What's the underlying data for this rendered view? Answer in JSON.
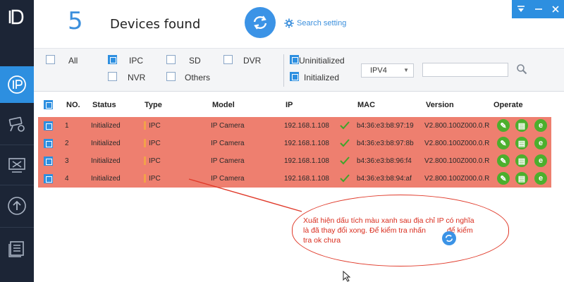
{
  "header": {
    "count": "5",
    "found_label": "Devices found",
    "search_setting": "Search setting"
  },
  "filters": {
    "all": "All",
    "ipc": "IPC",
    "sd": "SD",
    "dvr": "DVR",
    "nvr": "NVR",
    "others": "Others",
    "uninitialized": "Uninitialized",
    "initialized": "Initialized",
    "ip_version": "IPV4",
    "search_value": ""
  },
  "table": {
    "headers": {
      "no": "NO.",
      "status": "Status",
      "type": "Type",
      "model": "Model",
      "ip": "IP",
      "mac": "MAC",
      "version": "Version",
      "operate": "Operate"
    },
    "rows": [
      {
        "no": "1",
        "status": "Initialized",
        "type": "IPC",
        "model": "IP Camera",
        "ip": "192.168.1.108",
        "mac": "b4:36:e3:b8:97:19",
        "version": "V2.800.100Z000.0.R"
      },
      {
        "no": "2",
        "status": "Initialized",
        "type": "IPC",
        "model": "IP Camera",
        "ip": "192.168.1.108",
        "mac": "b4:36:e3:b8:97:8b",
        "version": "V2.800.100Z000.0.R"
      },
      {
        "no": "3",
        "status": "Initialized",
        "type": "IPC",
        "model": "IP Camera",
        "ip": "192.168.1.108",
        "mac": "b4:36:e3:b8:96:f4",
        "version": "V2.800.100Z000.0.R"
      },
      {
        "no": "4",
        "status": "Initialized",
        "type": "IPC",
        "model": "IP Camera",
        "ip": "192.168.1.108",
        "mac": "b4:36:e3:b8:94:af",
        "version": "V2.800.100Z000.0.R"
      }
    ]
  },
  "callout": {
    "line1": "Xuất hiện dấu tích màu xanh sau địa chỉ IP có nghĩa",
    "line2a": "là đã thay đổi xong. Để kiểm tra nhấn",
    "line2b": "để kiểm",
    "line3": "tra ok chưa"
  },
  "colors": {
    "accent": "#2d8fe0",
    "row_highlight": "#ee7f6f",
    "operate_green": "#4caf2d",
    "callout_red": "#d92b1c",
    "sidebar_bg": "#1c2536"
  },
  "icons": {
    "sidebar": [
      "ip-icon",
      "camera-settings-icon",
      "tools-icon",
      "upgrade-icon",
      "list-icon"
    ],
    "operate": [
      "edit-icon",
      "web-icon",
      "web-e-icon"
    ]
  }
}
